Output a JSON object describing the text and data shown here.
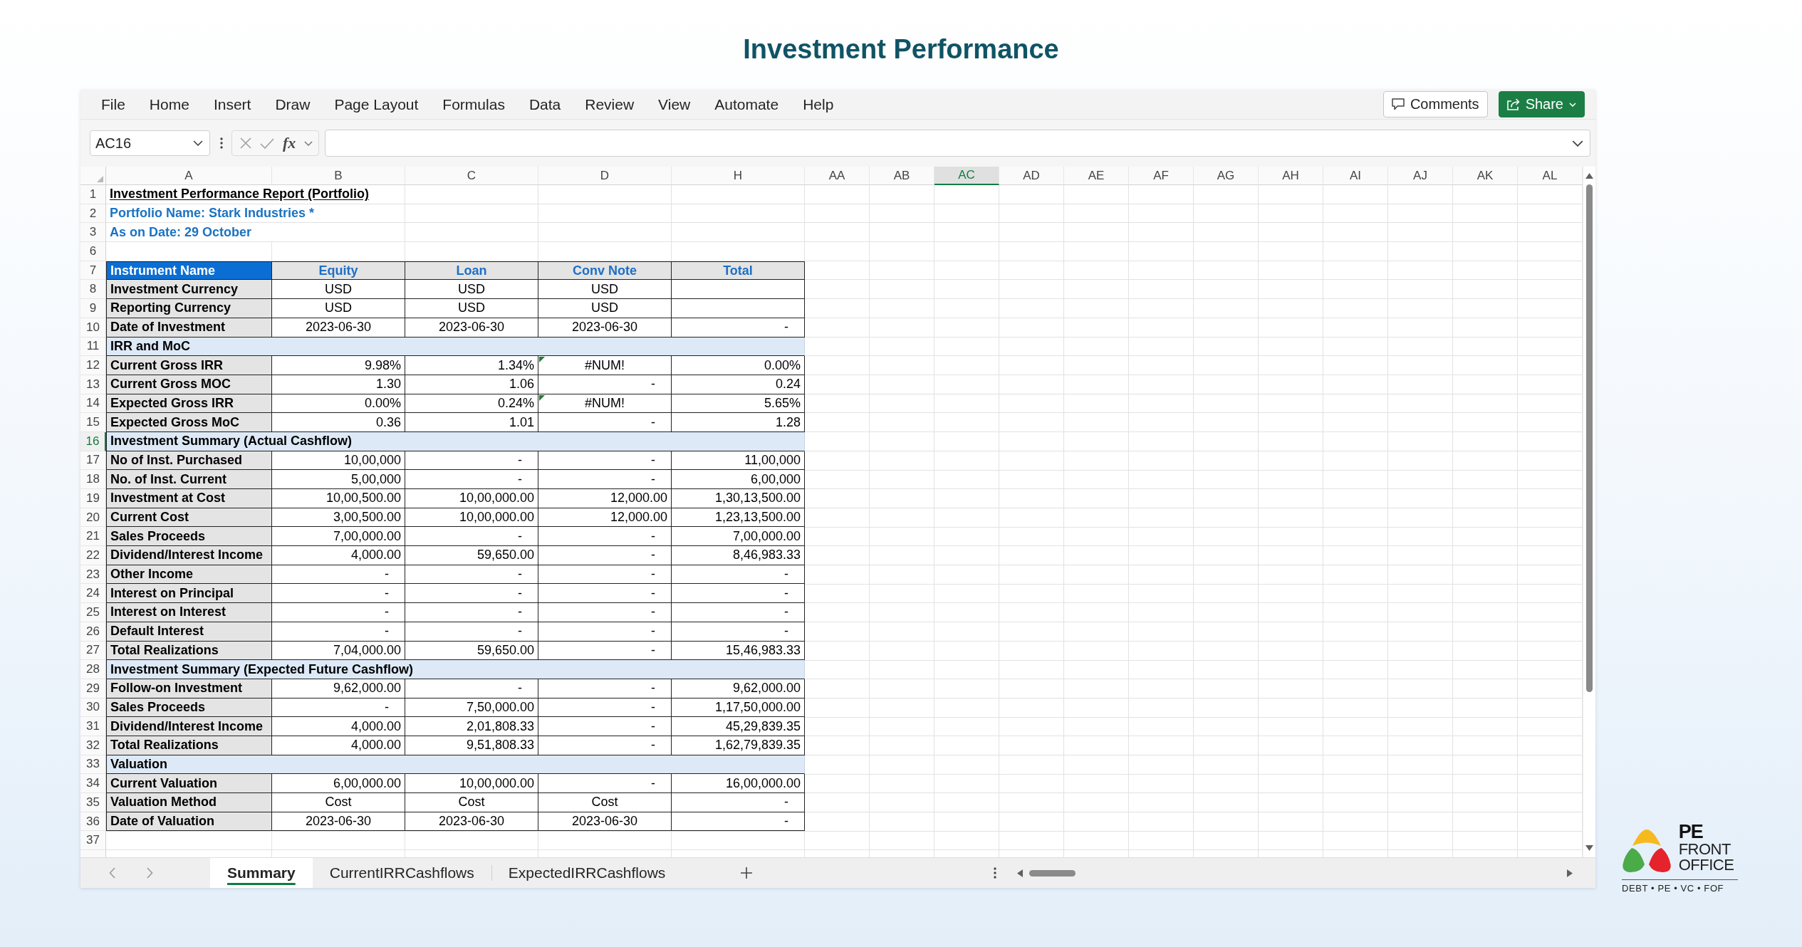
{
  "page_title": "Investment Performance",
  "window": {
    "menu": [
      "File",
      "Home",
      "Insert",
      "Draw",
      "Page Layout",
      "Formulas",
      "Data",
      "Review",
      "View",
      "Automate",
      "Help"
    ],
    "buttons": [
      {
        "label": "Comments",
        "kind": "comments"
      },
      {
        "label": "Share",
        "kind": "share"
      }
    ],
    "formula_bar": {
      "name_box": "AC16",
      "function_label": "fx"
    },
    "sheet": {
      "columns": [
        {
          "label": "A",
          "selected": false
        },
        {
          "label": "B",
          "selected": false
        },
        {
          "label": "C",
          "selected": false
        },
        {
          "label": "D",
          "selected": false
        },
        {
          "label": "H",
          "selected": false
        },
        {
          "label": "AA",
          "selected": false
        },
        {
          "label": "AB",
          "selected": false
        },
        {
          "label": "AC",
          "selected": true
        },
        {
          "label": "AD",
          "selected": false
        },
        {
          "label": "AE",
          "selected": false
        },
        {
          "label": "AF",
          "selected": false
        },
        {
          "label": "AG",
          "selected": false
        },
        {
          "label": "AH",
          "selected": false
        },
        {
          "label": "AI",
          "selected": false
        },
        {
          "label": "AJ",
          "selected": false
        },
        {
          "label": "AK",
          "selected": false
        },
        {
          "label": "AL",
          "selected": false
        }
      ],
      "rows": [
        {
          "number": "1",
          "selected": false,
          "kind": "title",
          "text": "Investment Performance Report (Portfolio)"
        },
        {
          "number": "2",
          "selected": false,
          "kind": "note",
          "text": "Portfolio Name: Stark Industries *"
        },
        {
          "number": "3",
          "selected": false,
          "kind": "note",
          "text": "As on Date: 29 October"
        },
        {
          "number": "6",
          "selected": false,
          "kind": "blank"
        },
        {
          "number": "7",
          "selected": false,
          "kind": "header",
          "label": "Instrument Name",
          "cells": [
            "Equity",
            "Loan",
            "Conv Note",
            "Total"
          ]
        },
        {
          "number": "8",
          "selected": false,
          "kind": "data",
          "label": "Investment Currency",
          "cells": [
            {
              "text": "USD",
              "kind": "text"
            },
            {
              "text": "USD",
              "kind": "text"
            },
            {
              "text": "USD",
              "kind": "text"
            }
          ]
        },
        {
          "number": "9",
          "selected": false,
          "kind": "data",
          "label": "Reporting Currency",
          "cells": [
            {
              "text": "USD",
              "kind": "text"
            },
            {
              "text": "USD",
              "kind": "text"
            },
            {
              "text": "USD",
              "kind": "text"
            }
          ]
        },
        {
          "number": "10",
          "selected": false,
          "kind": "data",
          "label": "Date of Investment",
          "cells": [
            {
              "text": "2023-06-30",
              "kind": "text"
            },
            {
              "text": "2023-06-30",
              "kind": "text"
            },
            {
              "text": "2023-06-30",
              "kind": "text"
            },
            {
              "text": "-",
              "kind": "nil"
            }
          ]
        },
        {
          "number": "11",
          "selected": false,
          "kind": "section",
          "label": "IRR and MoC"
        },
        {
          "number": "12",
          "selected": false,
          "kind": "data",
          "label": "Current Gross IRR",
          "cells": [
            {
              "text": "9.98%",
              "kind": "number"
            },
            {
              "text": "1.34%",
              "kind": "number"
            },
            {
              "text": "#NUM!",
              "kind": "error",
              "flagged": true
            },
            {
              "text": "0.00%",
              "kind": "number"
            }
          ]
        },
        {
          "number": "13",
          "selected": false,
          "kind": "data",
          "label": "Current Gross MOC",
          "cells": [
            {
              "text": "1.30",
              "kind": "number"
            },
            {
              "text": "1.06",
              "kind": "number"
            },
            {
              "text": "-",
              "kind": "nil"
            },
            {
              "text": "0.24",
              "kind": "number"
            }
          ]
        },
        {
          "number": "14",
          "selected": false,
          "kind": "data",
          "label": "Expected Gross IRR",
          "cells": [
            {
              "text": "0.00%",
              "kind": "number"
            },
            {
              "text": "0.24%",
              "kind": "number"
            },
            {
              "text": "#NUM!",
              "kind": "error",
              "flagged": true
            },
            {
              "text": "5.65%",
              "kind": "number"
            }
          ]
        },
        {
          "number": "15",
          "selected": false,
          "kind": "data",
          "label": "Expected Gross MoC",
          "cells": [
            {
              "text": "0.36",
              "kind": "number"
            },
            {
              "text": "1.01",
              "kind": "number"
            },
            {
              "text": "-",
              "kind": "nil"
            },
            {
              "text": "1.28",
              "kind": "number"
            }
          ]
        },
        {
          "number": "16",
          "selected": true,
          "kind": "section",
          "label": "Investment Summary (Actual Cashflow)"
        },
        {
          "number": "17",
          "selected": false,
          "kind": "data",
          "label": "No of Inst. Purchased",
          "cells": [
            {
              "text": "10,00,000",
              "kind": "number"
            },
            {
              "text": "-",
              "kind": "nil"
            },
            {
              "text": "-",
              "kind": "nil"
            },
            {
              "text": "11,00,000",
              "kind": "number"
            }
          ]
        },
        {
          "number": "18",
          "selected": false,
          "kind": "data",
          "label": "No. of Inst. Current",
          "cells": [
            {
              "text": "5,00,000",
              "kind": "number"
            },
            {
              "text": "-",
              "kind": "nil"
            },
            {
              "text": "-",
              "kind": "nil"
            },
            {
              "text": "6,00,000",
              "kind": "number"
            }
          ]
        },
        {
          "number": "19",
          "selected": false,
          "kind": "data",
          "label": "Investment at Cost",
          "cells": [
            {
              "text": "10,00,500.00",
              "kind": "number"
            },
            {
              "text": "10,00,000.00",
              "kind": "number"
            },
            {
              "text": "12,000.00",
              "kind": "number"
            },
            {
              "text": "1,30,13,500.00",
              "kind": "number"
            }
          ]
        },
        {
          "number": "20",
          "selected": false,
          "kind": "data",
          "label": "Current Cost",
          "cells": [
            {
              "text": "3,00,500.00",
              "kind": "number"
            },
            {
              "text": "10,00,000.00",
              "kind": "number"
            },
            {
              "text": "12,000.00",
              "kind": "number"
            },
            {
              "text": "1,23,13,500.00",
              "kind": "number"
            }
          ]
        },
        {
          "number": "21",
          "selected": false,
          "kind": "data",
          "label": "Sales Proceeds",
          "cells": [
            {
              "text": "7,00,000.00",
              "kind": "number"
            },
            {
              "text": "-",
              "kind": "nil"
            },
            {
              "text": "-",
              "kind": "nil"
            },
            {
              "text": "7,00,000.00",
              "kind": "number"
            }
          ]
        },
        {
          "number": "22",
          "selected": false,
          "kind": "data",
          "label": "Dividend/Interest Income",
          "cells": [
            {
              "text": "4,000.00",
              "kind": "number"
            },
            {
              "text": "59,650.00",
              "kind": "number"
            },
            {
              "text": "-",
              "kind": "nil"
            },
            {
              "text": "8,46,983.33",
              "kind": "number"
            }
          ]
        },
        {
          "number": "23",
          "selected": false,
          "kind": "data",
          "label": "Other Income",
          "cells": [
            {
              "text": "-",
              "kind": "nil"
            },
            {
              "text": "-",
              "kind": "nil"
            },
            {
              "text": "-",
              "kind": "nil"
            },
            {
              "text": "-",
              "kind": "nil"
            }
          ]
        },
        {
          "number": "24",
          "selected": false,
          "kind": "data",
          "label": "Interest on Principal",
          "cells": [
            {
              "text": "-",
              "kind": "nil"
            },
            {
              "text": "-",
              "kind": "nil"
            },
            {
              "text": "-",
              "kind": "nil"
            },
            {
              "text": "-",
              "kind": "nil"
            }
          ]
        },
        {
          "number": "25",
          "selected": false,
          "kind": "data",
          "label": "Interest on Interest",
          "cells": [
            {
              "text": "-",
              "kind": "nil"
            },
            {
              "text": "-",
              "kind": "nil"
            },
            {
              "text": "-",
              "kind": "nil"
            },
            {
              "text": "-",
              "kind": "nil"
            }
          ]
        },
        {
          "number": "26",
          "selected": false,
          "kind": "data",
          "label": "Default Interest",
          "cells": [
            {
              "text": "-",
              "kind": "nil"
            },
            {
              "text": "-",
              "kind": "nil"
            },
            {
              "text": "-",
              "kind": "nil"
            },
            {
              "text": "-",
              "kind": "nil"
            }
          ]
        },
        {
          "number": "27",
          "selected": false,
          "kind": "data",
          "label": "Total Realizations",
          "cells": [
            {
              "text": "7,04,000.00",
              "kind": "number"
            },
            {
              "text": "59,650.00",
              "kind": "number"
            },
            {
              "text": "-",
              "kind": "nil"
            },
            {
              "text": "15,46,983.33",
              "kind": "number"
            }
          ]
        },
        {
          "number": "28",
          "selected": false,
          "kind": "section",
          "label": "Investment Summary (Expected Future Cashflow)"
        },
        {
          "number": "29",
          "selected": false,
          "kind": "data",
          "label": "Follow-on Investment",
          "cells": [
            {
              "text": "9,62,000.00",
              "kind": "number"
            },
            {
              "text": "-",
              "kind": "nil"
            },
            {
              "text": "-",
              "kind": "nil"
            },
            {
              "text": "9,62,000.00",
              "kind": "number"
            }
          ]
        },
        {
          "number": "30",
          "selected": false,
          "kind": "data",
          "label": "Sales Proceeds",
          "cells": [
            {
              "text": "-",
              "kind": "nil"
            },
            {
              "text": "7,50,000.00",
              "kind": "number"
            },
            {
              "text": "-",
              "kind": "nil"
            },
            {
              "text": "1,17,50,000.00",
              "kind": "number"
            }
          ]
        },
        {
          "number": "31",
          "selected": false,
          "kind": "data",
          "label": "Dividend/Interest Income",
          "cells": [
            {
              "text": "4,000.00",
              "kind": "number"
            },
            {
              "text": "2,01,808.33",
              "kind": "number"
            },
            {
              "text": "-",
              "kind": "nil"
            },
            {
              "text": "45,29,839.35",
              "kind": "number"
            }
          ]
        },
        {
          "number": "32",
          "selected": false,
          "kind": "data",
          "label": "Total Realizations",
          "cells": [
            {
              "text": "4,000.00",
              "kind": "number"
            },
            {
              "text": "9,51,808.33",
              "kind": "number"
            },
            {
              "text": "-",
              "kind": "nil"
            },
            {
              "text": "1,62,79,839.35",
              "kind": "number"
            }
          ]
        },
        {
          "number": "33",
          "selected": false,
          "kind": "section",
          "label": "Valuation"
        },
        {
          "number": "34",
          "selected": false,
          "kind": "data",
          "label": "Current Valuation",
          "cells": [
            {
              "text": "6,00,000.00",
              "kind": "number"
            },
            {
              "text": "10,00,000.00",
              "kind": "number"
            },
            {
              "text": "-",
              "kind": "nil"
            },
            {
              "text": "16,00,000.00",
              "kind": "number"
            }
          ]
        },
        {
          "number": "35",
          "selected": false,
          "kind": "data",
          "label": "Valuation Method",
          "cells": [
            {
              "text": "Cost",
              "kind": "text"
            },
            {
              "text": "Cost",
              "kind": "text"
            },
            {
              "text": "Cost",
              "kind": "text"
            },
            {
              "text": "-",
              "kind": "nil"
            }
          ]
        },
        {
          "number": "36",
          "selected": false,
          "kind": "data",
          "label": "Date of Valuation",
          "cells": [
            {
              "text": "2023-06-30",
              "kind": "text"
            },
            {
              "text": "2023-06-30",
              "kind": "text"
            },
            {
              "text": "2023-06-30",
              "kind": "text"
            },
            {
              "text": "-",
              "kind": "nil"
            }
          ]
        },
        {
          "number": "37",
          "selected": false,
          "kind": "blank"
        }
      ]
    },
    "sheet_tabs": [
      {
        "label": "Summary",
        "selected": true
      },
      {
        "label": "CurrentIRRCashflows",
        "selected": false
      },
      {
        "label": "ExpectedIRRCashflows",
        "selected": false
      }
    ]
  },
  "logo": {
    "title": "PE",
    "lines": [
      "FRONT",
      "OFFICE"
    ],
    "tagline": "DEBT • PE • VC • FOF"
  }
}
